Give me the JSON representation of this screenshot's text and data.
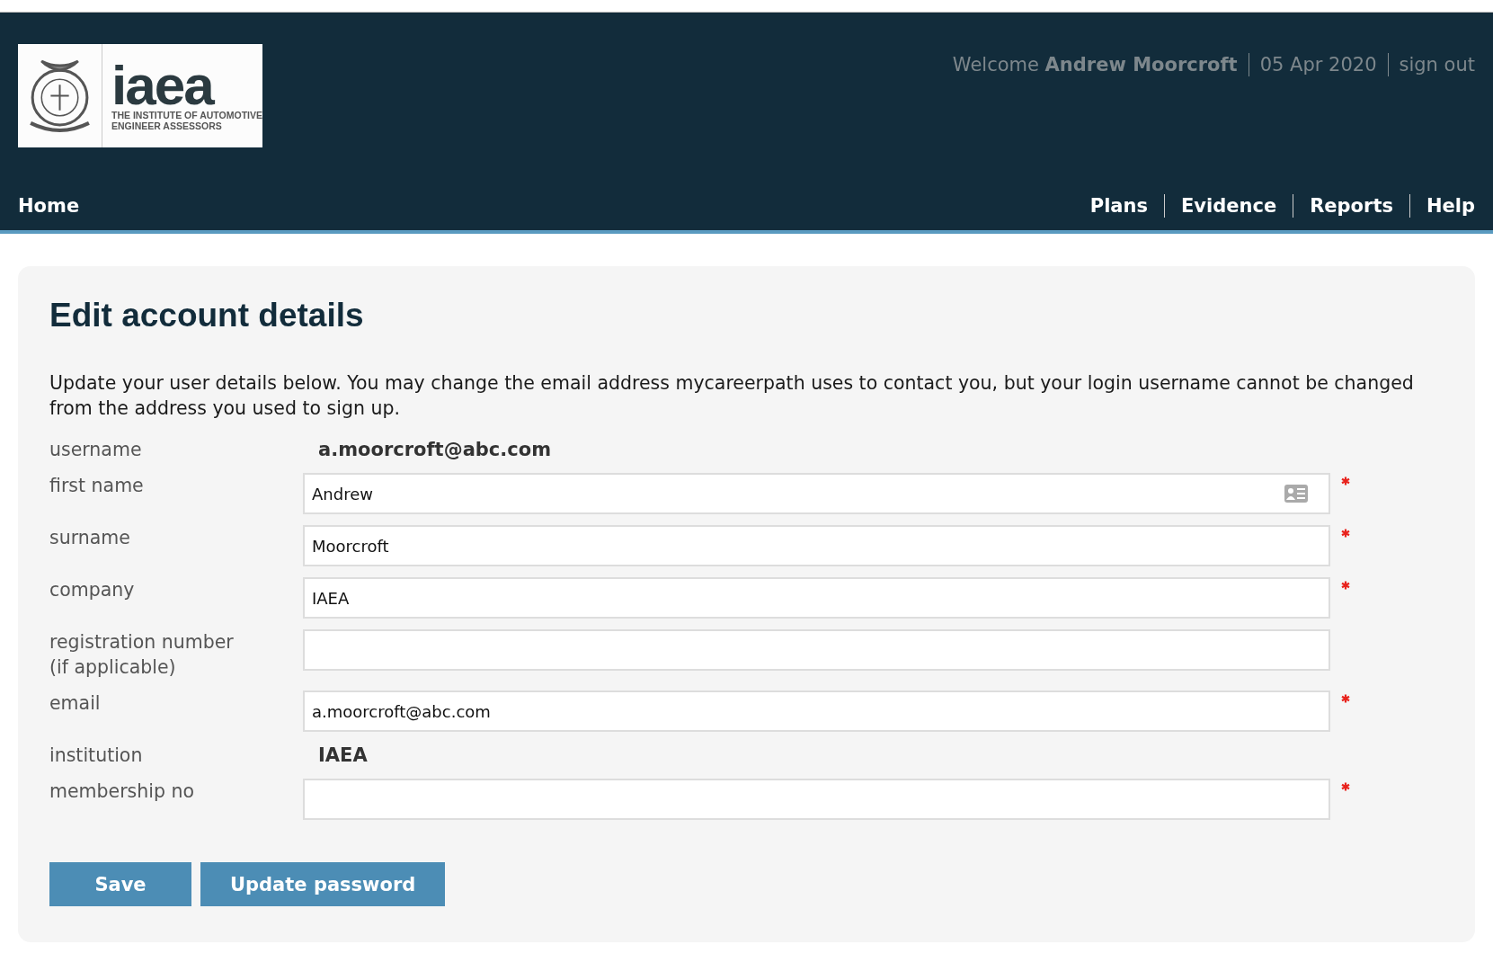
{
  "header": {
    "logo": {
      "wordmark": "iaea",
      "tagline": [
        "THE INSTITUTE OF AUTOMOTIVE",
        "ENGINEER ASSESSORS"
      ]
    },
    "welcome": {
      "prefix": "Welcome",
      "name": "Andrew Moorcroft",
      "date": "05 Apr 2020",
      "sign_out": "sign out"
    },
    "nav_left": "Home",
    "nav_right": [
      "Plans",
      "Evidence",
      "Reports",
      "Help"
    ]
  },
  "page": {
    "title": "Edit account details",
    "intro": "Update your user details below. You may change the email address mycareerpath uses to contact you, but your login username cannot be changed from the address you used to sign up.",
    "rows": [
      {
        "kind": "static",
        "label": "username",
        "value": "a.moorcroft@abc.com"
      },
      {
        "kind": "input",
        "label": "first name",
        "value": "Andrew",
        "required": true,
        "autofill_icon": true
      },
      {
        "kind": "input",
        "label": "surname",
        "value": "Moorcroft",
        "required": true,
        "autofill_icon": false
      },
      {
        "kind": "input",
        "label": "company",
        "value": "IAEA",
        "required": true,
        "autofill_icon": false
      },
      {
        "kind": "input",
        "label": "registration number (if applicable)",
        "value": "",
        "required": false,
        "autofill_icon": false
      },
      {
        "kind": "input",
        "label": "email",
        "value": "a.moorcroft@abc.com",
        "required": true,
        "autofill_icon": false
      },
      {
        "kind": "static",
        "label": "institution",
        "value": "IAEA"
      },
      {
        "kind": "input",
        "label": "membership no",
        "value": "",
        "required": true,
        "autofill_icon": false
      }
    ],
    "buttons": [
      "Save",
      "Update password"
    ]
  }
}
